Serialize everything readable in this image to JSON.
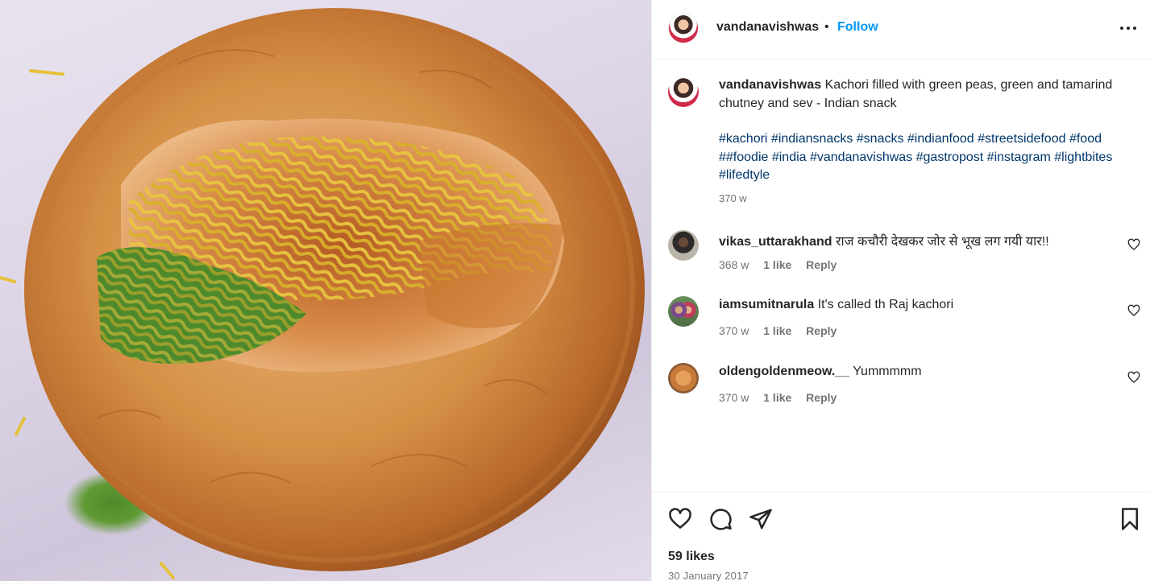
{
  "post": {
    "author": "vandanavishwas",
    "dot": "•",
    "follow_label": "Follow",
    "more_icon": "more-options-icon",
    "image_alt": "kachori-photo"
  },
  "caption": {
    "user": "vandanavishwas",
    "text": "Kachori filled with green peas, green and tamarind chutney and sev - Indian snack",
    "hashtags": "#kachori #indiansnacks #snacks #indianfood #streetsidefood #food ##foodie #india #vandanavishwas #gastropost #instagram #lightbites #lifedtyle",
    "time": "370 w"
  },
  "comments": [
    {
      "user": "vikas_uttarakhand",
      "text": "राज कचौरी देखकर जोर से भूख लग गयी यार!!",
      "time": "368 w",
      "likes": "1 like",
      "reply": "Reply"
    },
    {
      "user": "iamsumitnarula",
      "text": "It's called th Raj kachori",
      "time": "370 w",
      "likes": "1 like",
      "reply": "Reply"
    },
    {
      "user": "oldengoldenmeow.__",
      "text": "Yummmmm",
      "time": "370 w",
      "likes": "1 like",
      "reply": "Reply"
    }
  ],
  "footer": {
    "likes": "59 likes",
    "date": "30 January 2017",
    "icons": [
      "heart-icon",
      "comment-icon",
      "share-icon",
      "bookmark-icon"
    ]
  },
  "colors": {
    "link_blue": "#0095f6",
    "hashtag_blue": "#00376b",
    "muted": "#737373"
  }
}
